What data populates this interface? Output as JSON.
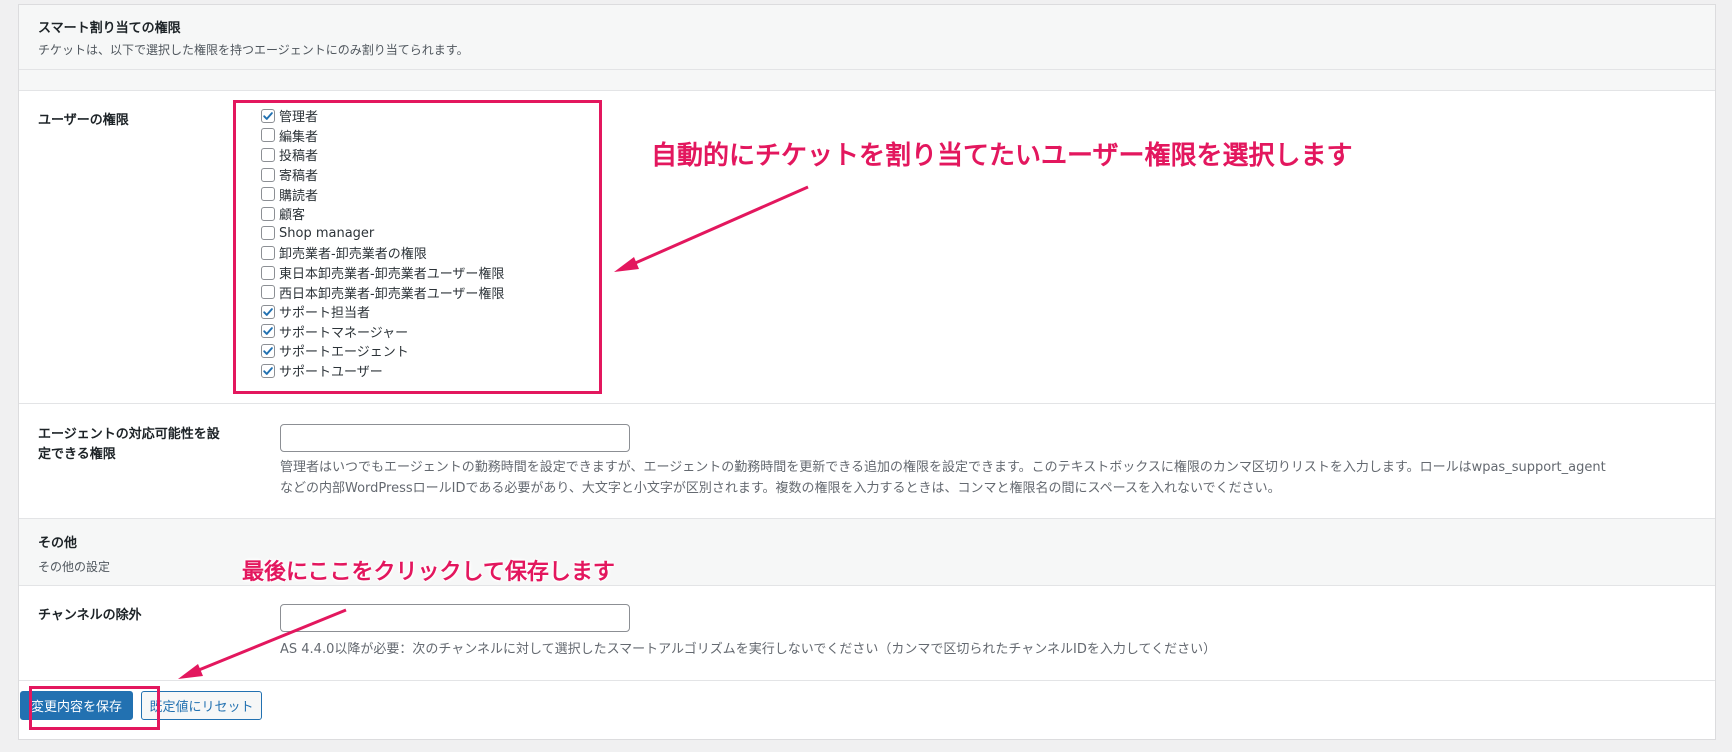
{
  "smart_assign": {
    "title": "スマート割り当ての権限",
    "description": "チケットは、以下で選択した権限を持つエージェントにのみ割り当てられます。"
  },
  "user_roles": {
    "label": "ユーザーの権限",
    "items": [
      {
        "label": "管理者",
        "checked": true
      },
      {
        "label": "編集者",
        "checked": false
      },
      {
        "label": "投稿者",
        "checked": false
      },
      {
        "label": "寄稿者",
        "checked": false
      },
      {
        "label": "購読者",
        "checked": false
      },
      {
        "label": "顧客",
        "checked": false
      },
      {
        "label": "Shop manager",
        "checked": false
      },
      {
        "label": "卸売業者-卸売業者の権限",
        "checked": false
      },
      {
        "label": "東日本卸売業者-卸売業者ユーザー権限",
        "checked": false
      },
      {
        "label": "西日本卸売業者-卸売業者ユーザー権限",
        "checked": false
      },
      {
        "label": "サポート担当者",
        "checked": true
      },
      {
        "label": "サポートマネージャー",
        "checked": true
      },
      {
        "label": "サポートエージェント",
        "checked": true
      },
      {
        "label": "サポートユーザー",
        "checked": true
      }
    ]
  },
  "agent_availability": {
    "label_line1": "エージェントの対応可能性を設",
    "label_line2": "定できる権限",
    "value": "",
    "help_line1": "管理者はいつでもエージェントの勤務時間を設定できますが、エージェントの勤務時間を更新できる追加の権限を設定できます。このテキストボックスに権限のカンマ区切りリストを入力します。ロールはwpas_support_agent",
    "help_line2": "などの内部WordPressロールIDである必要があり、大文字と小文字が区別されます。複数の権限を入力するときは、コンマと権限名の間にスペースを入れないでください。"
  },
  "other": {
    "title": "その他",
    "description": "その他の設定"
  },
  "channel_exclusion": {
    "label": "チャンネルの除外",
    "value": "",
    "help": "AS 4.4.0以降が必要：次のチャンネルに対して選択したスマートアルゴリズムを実行しないでください（カンマで区切られたチャンネルIDを入力してください）"
  },
  "buttons": {
    "save": "変更内容を保存",
    "reset": "既定値にリセット"
  },
  "annotations": {
    "roles_note": "自動的にチケットを割り当てたいユーザー権限を選択します",
    "save_note": "最後にここをクリックして保存します"
  },
  "colors": {
    "accent": "#2271b1",
    "annotation": "#e3175e",
    "panel_band": "#f6f7f7"
  }
}
